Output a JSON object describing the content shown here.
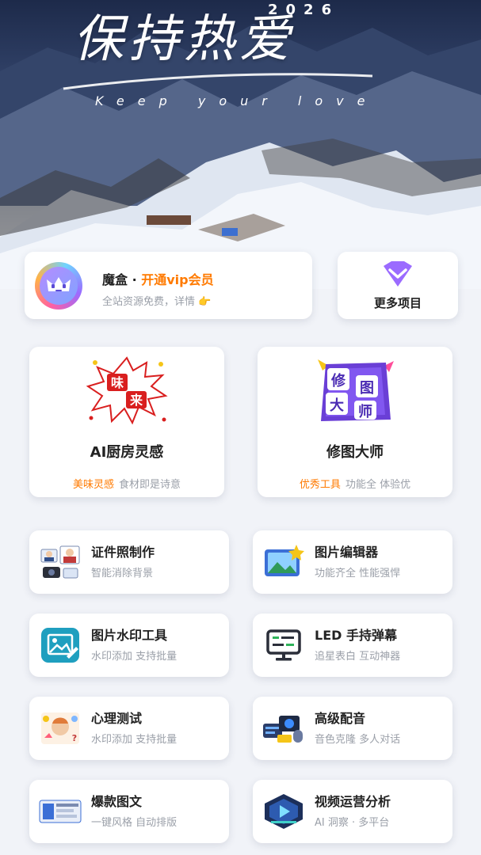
{
  "hero": {
    "title": "保持热爱",
    "year": "2026",
    "subtitle": "Keep your love"
  },
  "vip": {
    "brand": "魔盒 · ",
    "highlight": "开通vip会员",
    "desc": "全站资源免费，详情 👉"
  },
  "more": {
    "label": "更多项目"
  },
  "features": [
    {
      "art_text": "味来",
      "title": "AI厨房灵感",
      "tag": "美味灵感",
      "desc": "食材即是诗意"
    },
    {
      "art_text": "修图大师",
      "title": "修图大师",
      "tag": "优秀工具",
      "desc": "功能全 体验优"
    }
  ],
  "tools": [
    {
      "icon": "id-photo-icon",
      "title": "证件照制作",
      "desc": "智能消除背景"
    },
    {
      "icon": "image-editor-icon",
      "title": "图片编辑器",
      "desc": "功能齐全 性能强悍"
    },
    {
      "icon": "watermark-icon",
      "title": "图片水印工具",
      "desc": "水印添加 支持批量"
    },
    {
      "icon": "led-screen-icon",
      "title": "LED 手持弹幕",
      "desc": "追星表白 互动神器"
    },
    {
      "icon": "psych-test-icon",
      "title": "心理测试",
      "desc": "水印添加 支持批量"
    },
    {
      "icon": "dubbing-icon",
      "title": "高级配音",
      "desc": "音色克隆 多人对话"
    },
    {
      "icon": "layout-icon",
      "title": "爆款图文",
      "desc": "一键风格 自动排版"
    },
    {
      "icon": "video-analysis-icon",
      "title": "视频运营分析",
      "desc": "AI 洞察 · 多平台"
    }
  ],
  "colors": {
    "accent": "#ff7a00",
    "background": "#f1f3f8",
    "muted_text": "#9a9fa8"
  }
}
